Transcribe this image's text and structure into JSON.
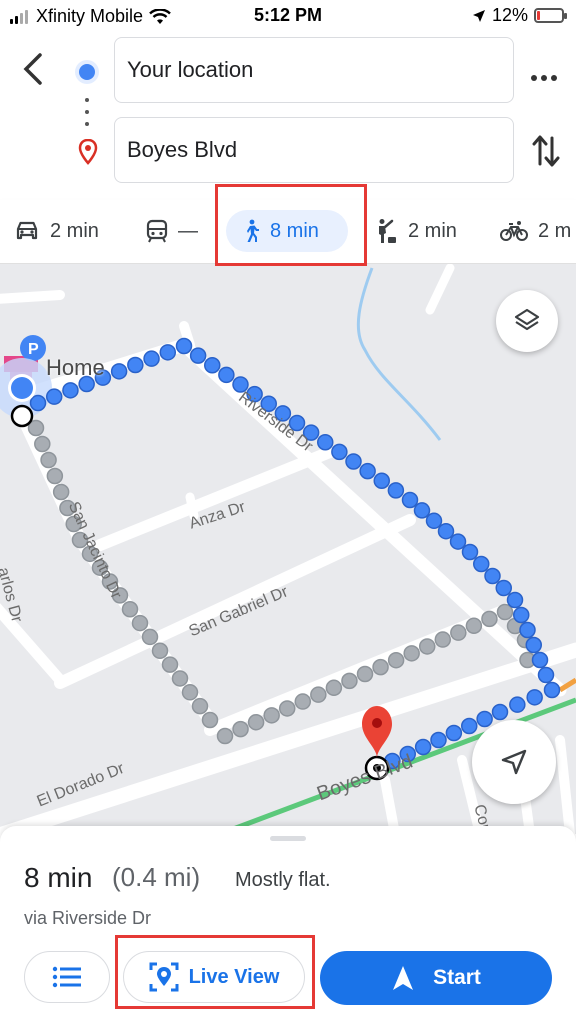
{
  "status_bar": {
    "carrier": "Xfinity Mobile",
    "time": "5:12 PM",
    "battery": "12%",
    "battery_level": 0.12
  },
  "route": {
    "from_value": "Your location",
    "to_value": "Boyes Blvd"
  },
  "modes": [
    {
      "name": "drive",
      "label": "2 min"
    },
    {
      "name": "transit",
      "label": "—"
    },
    {
      "name": "walk",
      "label": "8 min",
      "selected": true
    },
    {
      "name": "ride",
      "label": "2 min"
    },
    {
      "name": "bike",
      "label": "2 m"
    }
  ],
  "map": {
    "home_label": "Home",
    "streets": {
      "riverside": "Riverside Dr",
      "anza": "Anza Dr",
      "san_jacinto": "San Jacinto Dr",
      "san_gabriel": "San Gabriel Dr",
      "carlos": "arlos Dr",
      "el_dorado": "El Dorado Dr",
      "boyes": "Boyes Blvd",
      "cor": "Cor"
    }
  },
  "summary": {
    "duration": "8 min",
    "distance": "(0.4 mi)",
    "terrain": "Mostly flat.",
    "via": "via Riverside Dr",
    "live_view_label": "Live View",
    "start_label": "Start"
  },
  "colors": {
    "accent": "#1a73e8",
    "route_blue": "#4285f4",
    "alt_route_gray": "#a8adb3",
    "highlight_red": "#e53935"
  }
}
